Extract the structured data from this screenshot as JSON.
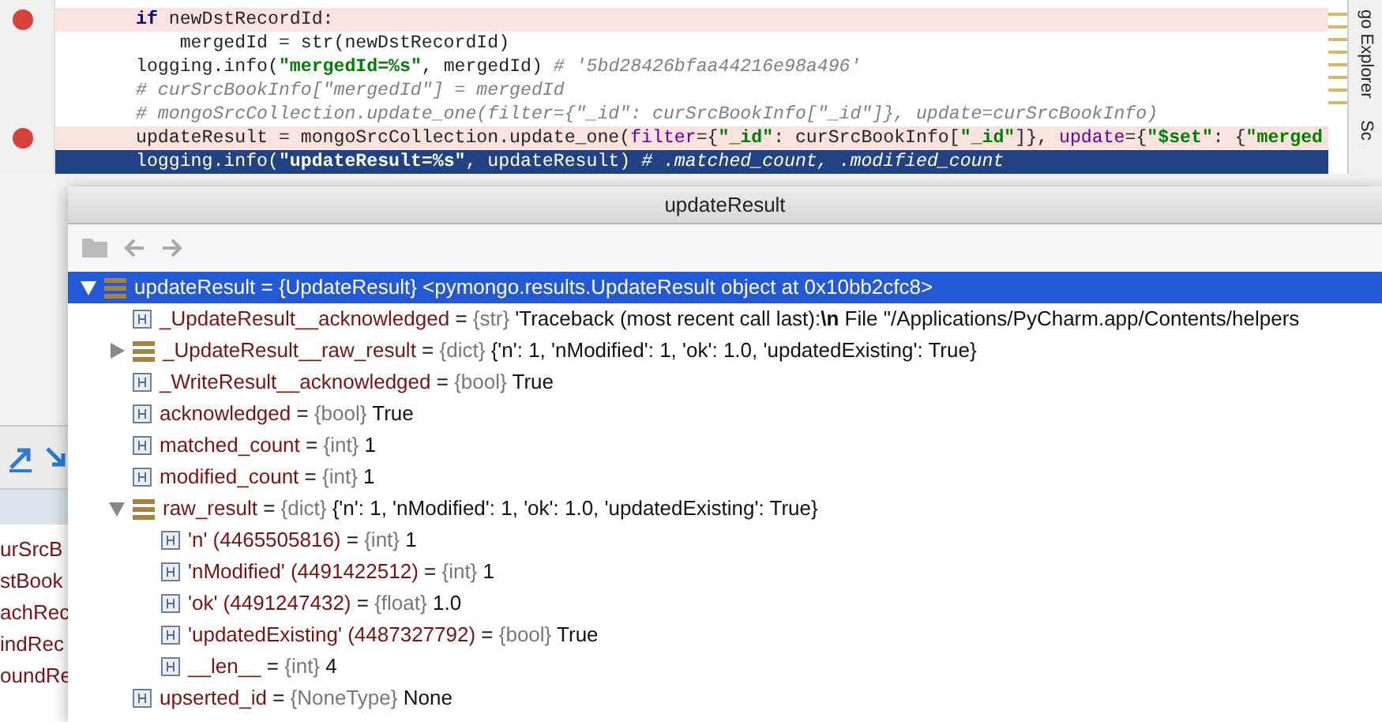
{
  "editor": {
    "lines": [
      {
        "breakpoint": true,
        "current": false,
        "tokens": [
          {
            "kind": "keyword",
            "text": "if"
          },
          {
            "kind": "plain",
            "text": " newDstRecordId:"
          }
        ]
      },
      {
        "breakpoint": false,
        "current": false,
        "tokens": [
          {
            "kind": "plain",
            "text": "    mergedId = str(newDstRecordId)"
          }
        ]
      },
      {
        "breakpoint": false,
        "current": false,
        "tokens": [
          {
            "kind": "plain",
            "text": "logging.info("
          },
          {
            "kind": "string",
            "text": "\"mergedId=%s\""
          },
          {
            "kind": "plain",
            "text": ", mergedId) "
          },
          {
            "kind": "comment",
            "text": "# '5bd28426bfaa44216e98a496'"
          }
        ]
      },
      {
        "breakpoint": false,
        "current": false,
        "tokens": [
          {
            "kind": "comment",
            "text": "# curSrcBookInfo[\"mergedId\"] = mergedId"
          }
        ]
      },
      {
        "breakpoint": false,
        "current": false,
        "tokens": [
          {
            "kind": "comment",
            "text": "# mongoSrcCollection.update_one(filter={\"_id\": curSrcBookInfo[\"_id\"]}, update=curSrcBookInfo)"
          }
        ]
      },
      {
        "breakpoint": true,
        "current": false,
        "tokens": [
          {
            "kind": "plain",
            "text": "updateResult = mongoSrcCollection.update_one("
          },
          {
            "kind": "param",
            "text": "filter"
          },
          {
            "kind": "plain",
            "text": "={"
          },
          {
            "kind": "string",
            "text": "\"_id\""
          },
          {
            "kind": "plain",
            "text": ": curSrcBookInfo["
          },
          {
            "kind": "string",
            "text": "\"_id\""
          },
          {
            "kind": "plain",
            "text": "]}, "
          },
          {
            "kind": "param",
            "text": "update"
          },
          {
            "kind": "plain",
            "text": "={"
          },
          {
            "kind": "string",
            "text": "\"$set\""
          },
          {
            "kind": "plain",
            "text": ": {"
          },
          {
            "kind": "string",
            "text": "\"merged"
          }
        ]
      },
      {
        "breakpoint": false,
        "current": true,
        "tokens": [
          {
            "kind": "plain",
            "text": "logging.info("
          },
          {
            "kind": "string",
            "text": "\"updateResult=%s\""
          },
          {
            "kind": "plain",
            "text": ", updateResult) "
          },
          {
            "kind": "comment",
            "text": "# .matched_count, .modified_count"
          }
        ]
      }
    ]
  },
  "right_tool_tabs": [
    {
      "label": "go Explorer"
    },
    {
      "label": "Sc"
    }
  ],
  "variables_panel": {
    "names": [
      "urSrcB",
      "stBook",
      "achRec",
      "indRec",
      "oundRe"
    ]
  },
  "popup": {
    "title": "updateResult",
    "tree": [
      {
        "kind": "object",
        "name": "updateResult",
        "equals": "=",
        "type": "{UpdateResult}",
        "value": "<pymongo.results.UpdateResult object at 0x10bb2cfc8>",
        "expanded": true,
        "selected": true,
        "children": [
          {
            "kind": "field",
            "name": "_UpdateResult__acknowledged",
            "equals": "=",
            "type": "{str}",
            "value": "'Traceback (most recent call last):**\\n**  File \"/Applications/PyCharm.app/Contents/helpers",
            "selected": false
          },
          {
            "kind": "object",
            "name": "_UpdateResult__raw_result",
            "equals": "=",
            "type": "{dict}",
            "value": "{'n': 1, 'nModified': 1, 'ok': 1.0, 'updatedExisting': True}",
            "expanded": false,
            "selected": false
          },
          {
            "kind": "field",
            "name": "_WriteResult__acknowledged",
            "equals": "=",
            "type": "{bool}",
            "value": "True",
            "selected": false
          },
          {
            "kind": "field",
            "name": "acknowledged",
            "equals": "=",
            "type": "{bool}",
            "value": "True",
            "selected": false
          },
          {
            "kind": "field",
            "name": "matched_count",
            "equals": "=",
            "type": "{int}",
            "value": "1",
            "selected": false
          },
          {
            "kind": "field",
            "name": "modified_count",
            "equals": "=",
            "type": "{int}",
            "value": "1",
            "selected": false
          },
          {
            "kind": "object",
            "name": "raw_result",
            "equals": "=",
            "type": "{dict}",
            "value": "{'n': 1, 'nModified': 1, 'ok': 1.0, 'updatedExisting': True}",
            "expanded": true,
            "selected": false,
            "children": [
              {
                "kind": "field",
                "name": "'n' (4465505816)",
                "equals": "=",
                "type": "{int}",
                "value": "1",
                "selected": false
              },
              {
                "kind": "field",
                "name": "'nModified' (4491422512)",
                "equals": "=",
                "type": "{int}",
                "value": "1",
                "selected": false
              },
              {
                "kind": "field",
                "name": "'ok' (4491247432)",
                "equals": "=",
                "type": "{float}",
                "value": "1.0",
                "selected": false
              },
              {
                "kind": "field",
                "name": "'updatedExisting' (4487327792)",
                "equals": "=",
                "type": "{bool}",
                "value": "True",
                "selected": false
              },
              {
                "kind": "field",
                "name": "__len__",
                "equals": "=",
                "type": "{int}",
                "value": "4",
                "selected": false
              }
            ]
          },
          {
            "kind": "field",
            "name": "upserted_id",
            "equals": "=",
            "type": "{NoneType}",
            "value": "None",
            "selected": false
          }
        ]
      }
    ]
  }
}
